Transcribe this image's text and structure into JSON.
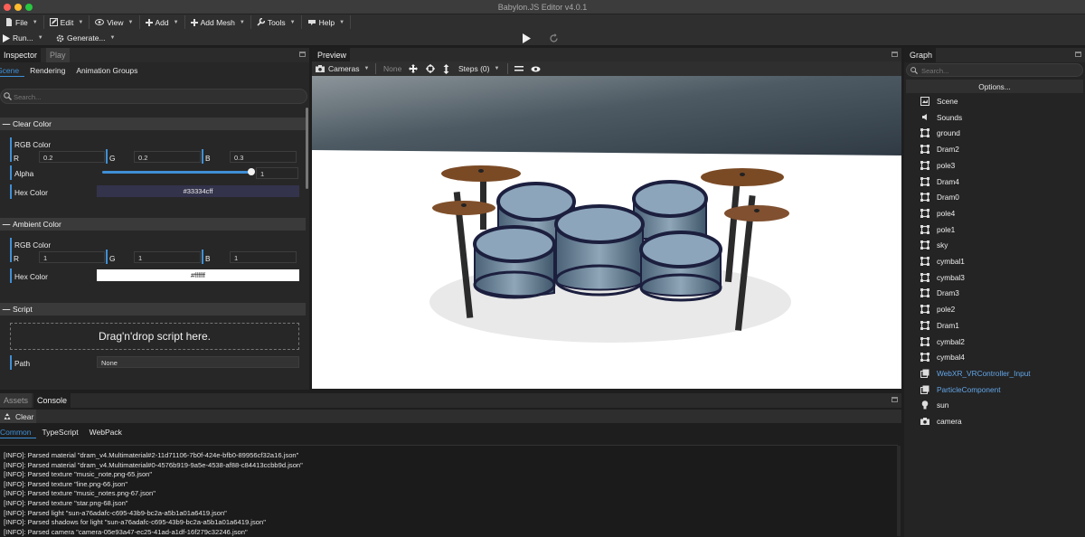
{
  "window": {
    "title": "Babylon.JS Editor v4.0.1"
  },
  "menubar": {
    "items": [
      {
        "label": "File",
        "icon": "file-icon"
      },
      {
        "label": "Edit",
        "icon": "edit-icon"
      },
      {
        "label": "View",
        "icon": "eye-icon"
      },
      {
        "label": "Add",
        "icon": "plus-icon"
      },
      {
        "label": "Add Mesh",
        "icon": "plus-icon"
      },
      {
        "label": "Tools",
        "icon": "wrench-icon"
      },
      {
        "label": "Help",
        "icon": "help-icon"
      }
    ]
  },
  "toolbar": {
    "run_label": "Run...",
    "generate_label": "Generate..."
  },
  "inspector": {
    "tabs": [
      "Inspector",
      "Play"
    ],
    "subtabs": [
      "Scene",
      "Rendering",
      "Animation Groups"
    ],
    "search_placeholder": "Search...",
    "clear_color": {
      "title": "Clear Color",
      "rgb_label": "RGB Color",
      "r_label": "R",
      "r_value": "0.2",
      "g_label": "G",
      "g_value": "0.2",
      "b_label": "B",
      "b_value": "0.3",
      "alpha_label": "Alpha",
      "alpha_value": "1",
      "alpha_fraction": 1,
      "hex_label": "Hex Color",
      "hex_value": "#33334cff",
      "hex_color": "#33334c"
    },
    "ambient_color": {
      "title": "Ambient Color",
      "rgb_label": "RGB Color",
      "r_label": "R",
      "r_value": "1",
      "g_label": "G",
      "g_value": "1",
      "b_label": "B",
      "b_value": "1",
      "hex_label": "Hex Color",
      "hex_value": "#ffffff",
      "hex_color": "#ffffff"
    },
    "script": {
      "title": "Script",
      "drop_text": "Drag'n'drop script here.",
      "path_label": "Path",
      "path_value": "None"
    }
  },
  "preview": {
    "title": "Preview",
    "cameras_label": "Cameras",
    "none_label": "None",
    "steps_label": "Steps (0)"
  },
  "graph": {
    "title": "Graph",
    "search_placeholder": "Search...",
    "options_label": "Options...",
    "items": [
      {
        "label": "Scene",
        "icon": "scene-icon",
        "kind": "scene"
      },
      {
        "label": "Sounds",
        "icon": "speaker-icon",
        "kind": "sound"
      },
      {
        "label": "ground",
        "icon": "mesh-icon",
        "kind": "mesh"
      },
      {
        "label": "Dram2",
        "icon": "mesh-icon",
        "kind": "mesh"
      },
      {
        "label": "pole3",
        "icon": "mesh-icon",
        "kind": "mesh"
      },
      {
        "label": "Dram4",
        "icon": "mesh-icon",
        "kind": "mesh"
      },
      {
        "label": "Dram0",
        "icon": "mesh-icon",
        "kind": "mesh"
      },
      {
        "label": "pole4",
        "icon": "mesh-icon",
        "kind": "mesh"
      },
      {
        "label": "pole1",
        "icon": "mesh-icon",
        "kind": "mesh"
      },
      {
        "label": "sky",
        "icon": "mesh-icon",
        "kind": "mesh"
      },
      {
        "label": "cymbal1",
        "icon": "mesh-icon",
        "kind": "mesh"
      },
      {
        "label": "cymbal3",
        "icon": "mesh-icon",
        "kind": "mesh"
      },
      {
        "label": "Dram3",
        "icon": "mesh-icon",
        "kind": "mesh"
      },
      {
        "label": "pole2",
        "icon": "mesh-icon",
        "kind": "mesh"
      },
      {
        "label": "Dram1",
        "icon": "mesh-icon",
        "kind": "mesh"
      },
      {
        "label": "cymbal2",
        "icon": "mesh-icon",
        "kind": "mesh"
      },
      {
        "label": "cymbal4",
        "icon": "mesh-icon",
        "kind": "mesh"
      },
      {
        "label": "WebXR_VRController_Input",
        "icon": "transform-node-icon",
        "kind": "node",
        "color": "#62a6e8"
      },
      {
        "label": "ParticleComponent",
        "icon": "transform-node-icon",
        "kind": "node",
        "color": "#62a6e8"
      },
      {
        "label": "sun",
        "icon": "light-bulb-icon",
        "kind": "light"
      },
      {
        "label": "camera",
        "icon": "camera-icon",
        "kind": "camera"
      }
    ]
  },
  "console": {
    "tabs": [
      "Assets",
      "Console"
    ],
    "clear_label": "Clear",
    "subtabs": [
      "Common",
      "TypeScript",
      "WebPack"
    ],
    "lines": [
      "[INFO]: Parsed material \"dram_v4.Multimaterial#2-11d71106-7b0f-424e-bfb0-89956cf32a16.json\"",
      "[INFO]: Parsed material \"dram_v4.Multimaterial#0-4576b919-9a5e-4538-af88-c84413ccbb9d.json\"",
      "[INFO]: Parsed texture \"music_note.png-65.json\"",
      "[INFO]: Parsed texture \"line.png-66.json\"",
      "[INFO]: Parsed texture \"music_notes.png-67.json\"",
      "[INFO]: Parsed texture \"star.png-68.json\"",
      "[INFO]: Parsed light \"sun-a76adafc-c695-43b9-bc2a-a5b1a01a6419.json\"",
      "[INFO]: Parsed shadows for light \"sun-a76adafc-c695-43b9-bc2a-a5b1a01a6419.json\"",
      "[INFO]: Parsed camera \"camera-05e93a47-ec25-41ad-a1df-16f279c32246.json\""
    ]
  },
  "colors": {
    "accent": "#3f8fd6",
    "node_text": "#62a6e8"
  }
}
